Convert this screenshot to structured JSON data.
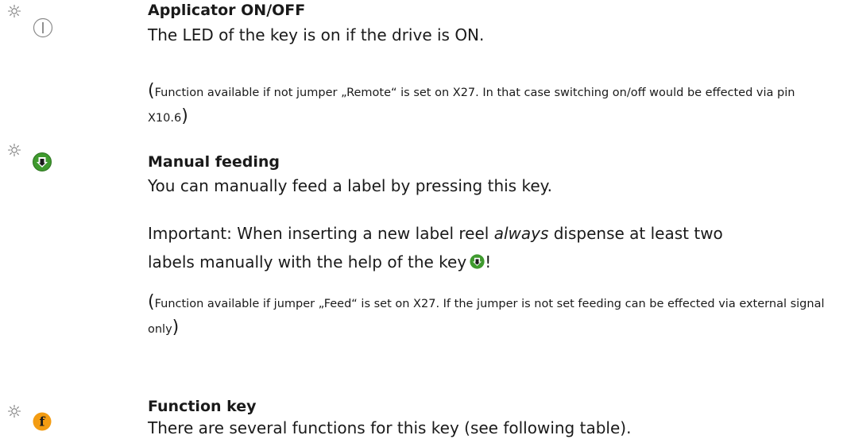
{
  "sections": [
    {
      "icons": [
        "sun-icon",
        "power-key-icon"
      ],
      "title": "Applicator ON/OFF",
      "body": "The LED of the key is on if the drive is ON.",
      "note_open": "(",
      "note": "Function available if not jumper „Remote“ is set on X27. In that case switching on/off would be effected via pin X10.6",
      "note_close": ")"
    },
    {
      "icons": [
        "sun-icon",
        "feed-key-icon"
      ],
      "title": "Manual feeding",
      "body": "You can manually feed a label by pressing this key.",
      "important_1": "Important: When inserting a new label reel ",
      "important_em": "always",
      "important_2": " dispense at least two",
      "important_3": "labels manually with the help of the key",
      "important_end": "!",
      "note_open": "(",
      "note": "Function available if jumper „Feed“ is set on X27. If the jumper is not set feeding can be effected via external signal only",
      "note_close": ")"
    },
    {
      "icons": [
        "sun-icon",
        "function-key-icon"
      ],
      "title": "Function key",
      "body": "There are several functions for this key (see following table).",
      "key_letter": "f"
    }
  ],
  "colors": {
    "feed_key": "#3f9a2e",
    "function_key": "#f39c12",
    "power_key_outline": "#8a8a8a",
    "sun": "#7a7a7a"
  }
}
